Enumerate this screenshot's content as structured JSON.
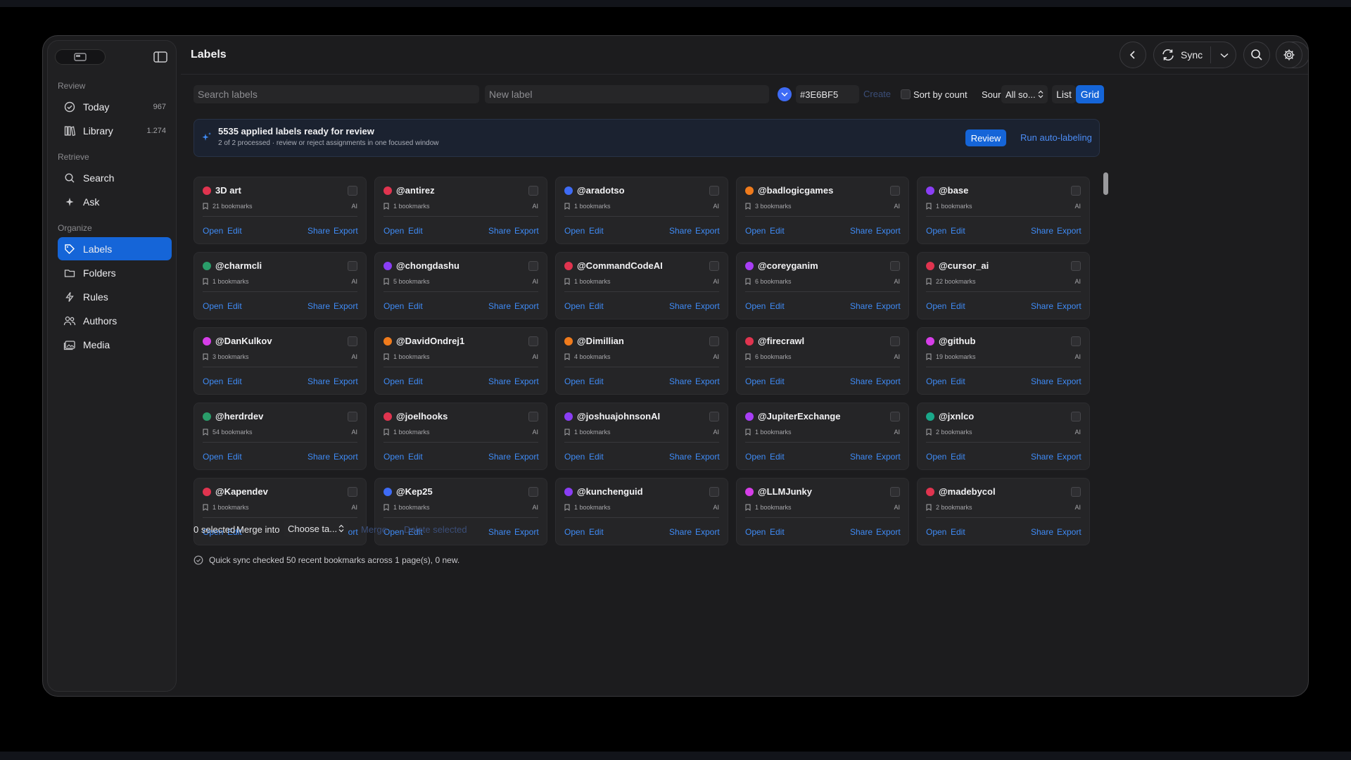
{
  "sidebar": {
    "sections": [
      {
        "label": "Review"
      },
      {
        "label": "Retrieve"
      },
      {
        "label": "Organize"
      }
    ],
    "items": [
      {
        "label": "Today",
        "count": "967",
        "icon": "check-circle-icon"
      },
      {
        "label": "Library",
        "count": "1.274",
        "icon": "library-icon"
      },
      {
        "label": "Search",
        "icon": "search-icon"
      },
      {
        "label": "Ask",
        "icon": "sparkle-icon"
      },
      {
        "label": "Labels",
        "icon": "tag-icon"
      },
      {
        "label": "Folders",
        "icon": "folder-icon"
      },
      {
        "label": "Rules",
        "icon": "bolt-icon"
      },
      {
        "label": "Authors",
        "icon": "people-icon"
      },
      {
        "label": "Media",
        "icon": "media-icon"
      }
    ]
  },
  "header": {
    "title": "Labels",
    "sync_label": "Sync"
  },
  "toolbar": {
    "search_placeholder": "Search labels",
    "new_label_placeholder": "New label",
    "color_hex": "#3E6BF5",
    "create_label": "Create",
    "sort_label": "Sort by count",
    "source_label": "Source",
    "source_value": "All so...",
    "list_label": "List",
    "grid_label": "Grid"
  },
  "banner": {
    "title": "5535 applied labels ready for review",
    "subtitle": "2 of 2 processed · review or reject assignments in one focused window",
    "review_label": "Review",
    "auto_label": "Run auto-labeling"
  },
  "card_actions": {
    "open": "Open",
    "edit": "Edit",
    "share": "Share",
    "export": "Export",
    "ai": "AI"
  },
  "labels": [
    {
      "name": "3D art",
      "bookmarks": "21 bookmarks",
      "color": "#e0344f"
    },
    {
      "name": "@antirez",
      "bookmarks": "1 bookmarks",
      "color": "#e0344f"
    },
    {
      "name": "@aradotso",
      "bookmarks": "1 bookmarks",
      "color": "#3e6bf5"
    },
    {
      "name": "@badlogicgames",
      "bookmarks": "3 bookmarks",
      "color": "#f07b1c"
    },
    {
      "name": "@base",
      "bookmarks": "1 bookmarks",
      "color": "#8a3ef5"
    },
    {
      "name": "@charmcli",
      "bookmarks": "1 bookmarks",
      "color": "#2a9d6a"
    },
    {
      "name": "@chongdashu",
      "bookmarks": "5 bookmarks",
      "color": "#8a3ef5"
    },
    {
      "name": "@CommandCodeAI",
      "bookmarks": "1 bookmarks",
      "color": "#e0344f"
    },
    {
      "name": "@coreyganim",
      "bookmarks": "6 bookmarks",
      "color": "#a83ef5"
    },
    {
      "name": "@cursor_ai",
      "bookmarks": "22 bookmarks",
      "color": "#e0344f"
    },
    {
      "name": "@DanKulkov",
      "bookmarks": "3 bookmarks",
      "color": "#d63ee8"
    },
    {
      "name": "@DavidOndrej1",
      "bookmarks": "1 bookmarks",
      "color": "#f07b1c"
    },
    {
      "name": "@Dimillian",
      "bookmarks": "4 bookmarks",
      "color": "#f07b1c"
    },
    {
      "name": "@firecrawl",
      "bookmarks": "6 bookmarks",
      "color": "#e0344f"
    },
    {
      "name": "@github",
      "bookmarks": "19 bookmarks",
      "color": "#d63ee8"
    },
    {
      "name": "@herdrdev",
      "bookmarks": "54 bookmarks",
      "color": "#2a9d6a"
    },
    {
      "name": "@joelhooks",
      "bookmarks": "1 bookmarks",
      "color": "#e0344f"
    },
    {
      "name": "@joshuajohnsonAI",
      "bookmarks": "1 bookmarks",
      "color": "#8a3ef5"
    },
    {
      "name": "@JupiterExchange",
      "bookmarks": "1 bookmarks",
      "color": "#a83ef5"
    },
    {
      "name": "@jxnlco",
      "bookmarks": "2 bookmarks",
      "color": "#1aa88a"
    },
    {
      "name": "@Kapendev",
      "bookmarks": "1 bookmarks",
      "color": "#e0344f"
    },
    {
      "name": "@Kep25",
      "bookmarks": "1 bookmarks",
      "color": "#3e6bf5"
    },
    {
      "name": "@kunchenguid",
      "bookmarks": "1 bookmarks",
      "color": "#8a3ef5"
    },
    {
      "name": "@LLMJunky",
      "bookmarks": "1 bookmarks",
      "color": "#d63ee8"
    },
    {
      "name": "@madebycol",
      "bookmarks": "2 bookmarks",
      "color": "#e0344f"
    }
  ],
  "bottom": {
    "selected": "0 selected",
    "merge_into": "Merge into",
    "merge_target": "Choose ta...",
    "merge_btn": "Merge",
    "delete_btn": "Delete selected",
    "status": "Quick sync checked 50 recent bookmarks across 1 page(s), 0 new."
  },
  "colors": {
    "accent": "#1565d8",
    "link": "#3f8bf5"
  }
}
